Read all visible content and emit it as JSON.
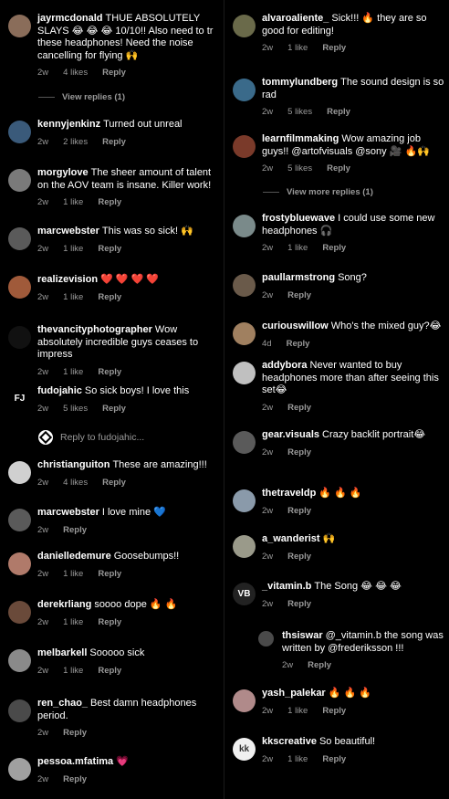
{
  "left": [
    {
      "user": "jayrmcdonald",
      "text": "THUE ABSOLUTELY SLAYS 😂 😂 😂 10/10!! Also need to tr these headphones! Need the noise cancelling for flying 🙌",
      "time": "2w",
      "likes": "4 likes",
      "reply": "Reply",
      "color": "#8a6d5a"
    },
    {
      "user": "kennyjenkinz",
      "text": "Turned out unreal",
      "time": "2w",
      "likes": "2 likes",
      "reply": "Reply",
      "color": "#3a5a7a"
    },
    {
      "user": "morgylove",
      "text": "The sheer amount of talent on the AOV team is insane. Killer work!",
      "time": "2w",
      "likes": "1 like",
      "reply": "Reply",
      "color": "#7a7a7a"
    },
    {
      "user": "marcwebster",
      "text": "This was so sick! 🙌",
      "time": "2w",
      "likes": "1 like",
      "reply": "Reply",
      "color": "#5a5a5a"
    },
    {
      "user": "realizevision",
      "text": "❤️ ❤️ ❤️ ❤️",
      "time": "2w",
      "likes": "1 like",
      "reply": "Reply",
      "color": "#a05a3a"
    },
    {
      "user": "thevancityphotographer",
      "text": "Wow absolutely incredible guys ceases to impress",
      "time": "2w",
      "likes": "1 like",
      "reply": "Reply",
      "color": "#111"
    },
    {
      "user": "fudojahic",
      "text": "So sick boys! I love this",
      "time": "2w",
      "likes": "5 likes",
      "reply": "Reply",
      "color": "#000",
      "glyph": "FJ"
    },
    {
      "user": "christianguiton",
      "text": "These are amazing!!!",
      "time": "2w",
      "likes": "4 likes",
      "reply": "Reply",
      "color": "#d0d0d0"
    },
    {
      "user": "marcwebster",
      "text": "I love mine 💙",
      "time": "2w",
      "likes": "",
      "reply": "Reply",
      "color": "#5a5a5a"
    },
    {
      "user": "danielledemure",
      "text": "Goosebumps!!",
      "time": "2w",
      "likes": "1 like",
      "reply": "Reply",
      "color": "#b07a6a"
    },
    {
      "user": "derekrliang",
      "text": "soooo dope 🔥 🔥",
      "time": "2w",
      "likes": "1 like",
      "reply": "Reply",
      "color": "#6a4a3a"
    },
    {
      "user": "melbarkell",
      "text": "Sooooo sick",
      "time": "2w",
      "likes": "1 like",
      "reply": "Reply",
      "color": "#8a8a8a"
    },
    {
      "user": "ren_chao_",
      "text": "Best damn headphones period.",
      "time": "2w",
      "likes": "",
      "reply": "Reply",
      "color": "#4a4a4a"
    },
    {
      "user": "pessoa.mfatima",
      "text": "💗",
      "time": "2w",
      "likes": "",
      "reply": "Reply",
      "color": "#a0a0a0"
    }
  ],
  "left_view_replies": "View replies (1)",
  "reply_to": "Reply to fudojahic...",
  "right": [
    {
      "user": "alvaroaliente_",
      "text": "Sick!!! 🔥 they are so good for editing!",
      "time": "2w",
      "likes": "1 like",
      "reply": "Reply",
      "color": "#6a6a4a"
    },
    {
      "user": "tommylundberg",
      "text": "The sound design is so rad",
      "time": "2w",
      "likes": "5 likes",
      "reply": "Reply",
      "color": "#3a6a8a"
    },
    {
      "user": "learnfilmmaking",
      "text": "Wow amazing job guys!! @artofvisuals @sony 🎥 🔥🙌",
      "time": "2w",
      "likes": "5 likes",
      "reply": "Reply",
      "color": "#7a3a2a"
    },
    {
      "user": "frostybluewave",
      "text": "I could use some new headphones 🎧",
      "time": "2w",
      "likes": "1 like",
      "reply": "Reply",
      "color": "#7a8a8a"
    },
    {
      "user": "paullarmstrong",
      "text": "Song?",
      "time": "2w",
      "likes": "",
      "reply": "Reply",
      "color": "#6a5a4a"
    },
    {
      "user": "curiouswillow",
      "text": "Who's the mixed guy?😂",
      "time": "4d",
      "likes": "",
      "reply": "Reply",
      "color": "#a08060"
    },
    {
      "user": "addybora",
      "text": "Never wanted to buy headphones more than after seeing this set😂",
      "time": "2w",
      "likes": "",
      "reply": "Reply",
      "color": "#c0c0c0"
    },
    {
      "user": "gear.visuals",
      "text": "Crazy backlit portrait😂",
      "time": "2w",
      "likes": "",
      "reply": "Reply",
      "color": "#5a5a5a"
    },
    {
      "user": "thetraveldp",
      "text": "🔥 🔥 🔥",
      "time": "2w",
      "likes": "",
      "reply": "Reply",
      "color": "#8a9aaa"
    },
    {
      "user": "a_wanderist",
      "text": "🙌",
      "time": "2w",
      "likes": "",
      "reply": "Reply",
      "color": "#9a9a8a"
    },
    {
      "user": "_vitamin.b",
      "text": "The Song 😂 😂 😂",
      "time": "2w",
      "likes": "",
      "reply": "Reply",
      "color": "#222",
      "glyph": "VB"
    },
    {
      "user": "yash_palekar",
      "text": "🔥 🔥 🔥",
      "time": "2w",
      "likes": "1 like",
      "reply": "Reply",
      "color": "#b08a8a"
    },
    {
      "user": "kkscreative",
      "text": "So beautiful!",
      "time": "2w",
      "likes": "1 like",
      "reply": "Reply",
      "color": "#f0f0f0",
      "glyph": "kk"
    }
  ],
  "right_view_replies": "View more replies (1)",
  "nested": {
    "user": "thsiswar",
    "text": "@_vitamin.b the song was written by @frederiksson !!!",
    "time": "2w",
    "reply": "Reply",
    "color": "#4a4a4a"
  }
}
